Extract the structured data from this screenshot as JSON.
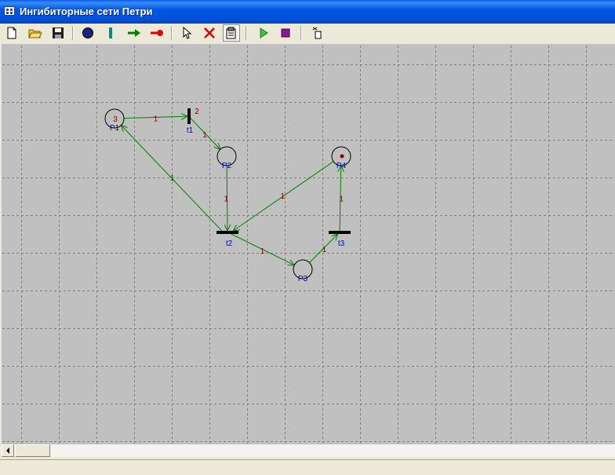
{
  "window": {
    "title": "Ингибиторные сети Петри"
  },
  "toolbar": {
    "buttons": [
      {
        "name": "new-file-icon"
      },
      {
        "name": "open-folder-icon"
      },
      {
        "name": "save-disk-icon"
      },
      {
        "name": "place-tool-icon"
      },
      {
        "name": "transition-tool-icon"
      },
      {
        "name": "arc-tool-icon"
      },
      {
        "name": "inhibitor-arc-tool-icon"
      },
      {
        "name": "select-pointer-icon"
      },
      {
        "name": "delete-x-icon"
      },
      {
        "name": "properties-icon"
      },
      {
        "name": "run-play-icon"
      },
      {
        "name": "stop-icon"
      },
      {
        "name": "step-icon"
      }
    ]
  },
  "colors": {
    "arc": "#008000",
    "weight_label": "#800000",
    "name_label": "#0000cc",
    "canvas": "#c0c0c0",
    "grid": "#808080",
    "token": "#8b0000"
  },
  "net": {
    "places": [
      {
        "name": "P1",
        "tokens_label": "3"
      },
      {
        "name": "P2",
        "tokens_label": ""
      },
      {
        "name": "P3",
        "tokens_label": ""
      },
      {
        "name": "P4",
        "tokens_label": "",
        "dot": true
      }
    ],
    "transitions": [
      {
        "name": "t1",
        "orientation": "vertical",
        "priority": "2"
      },
      {
        "name": "t2",
        "orientation": "horizontal"
      },
      {
        "name": "t3",
        "orientation": "horizontal"
      }
    ],
    "arcs": [
      {
        "from": "P1",
        "to": "t1",
        "weight": "1"
      },
      {
        "from": "t1",
        "to": "P2",
        "weight": "1"
      },
      {
        "from": "P2",
        "to": "t2",
        "weight": "1"
      },
      {
        "from": "t2",
        "to": "P1",
        "weight": "1"
      },
      {
        "from": "P4",
        "to": "t2",
        "weight": "1"
      },
      {
        "from": "t2",
        "to": "P3",
        "weight": "1"
      },
      {
        "from": "P3",
        "to": "t3",
        "weight": "1"
      },
      {
        "from": "t3",
        "to": "P4",
        "weight": "1"
      }
    ]
  },
  "statusbar": {
    "text": ""
  }
}
